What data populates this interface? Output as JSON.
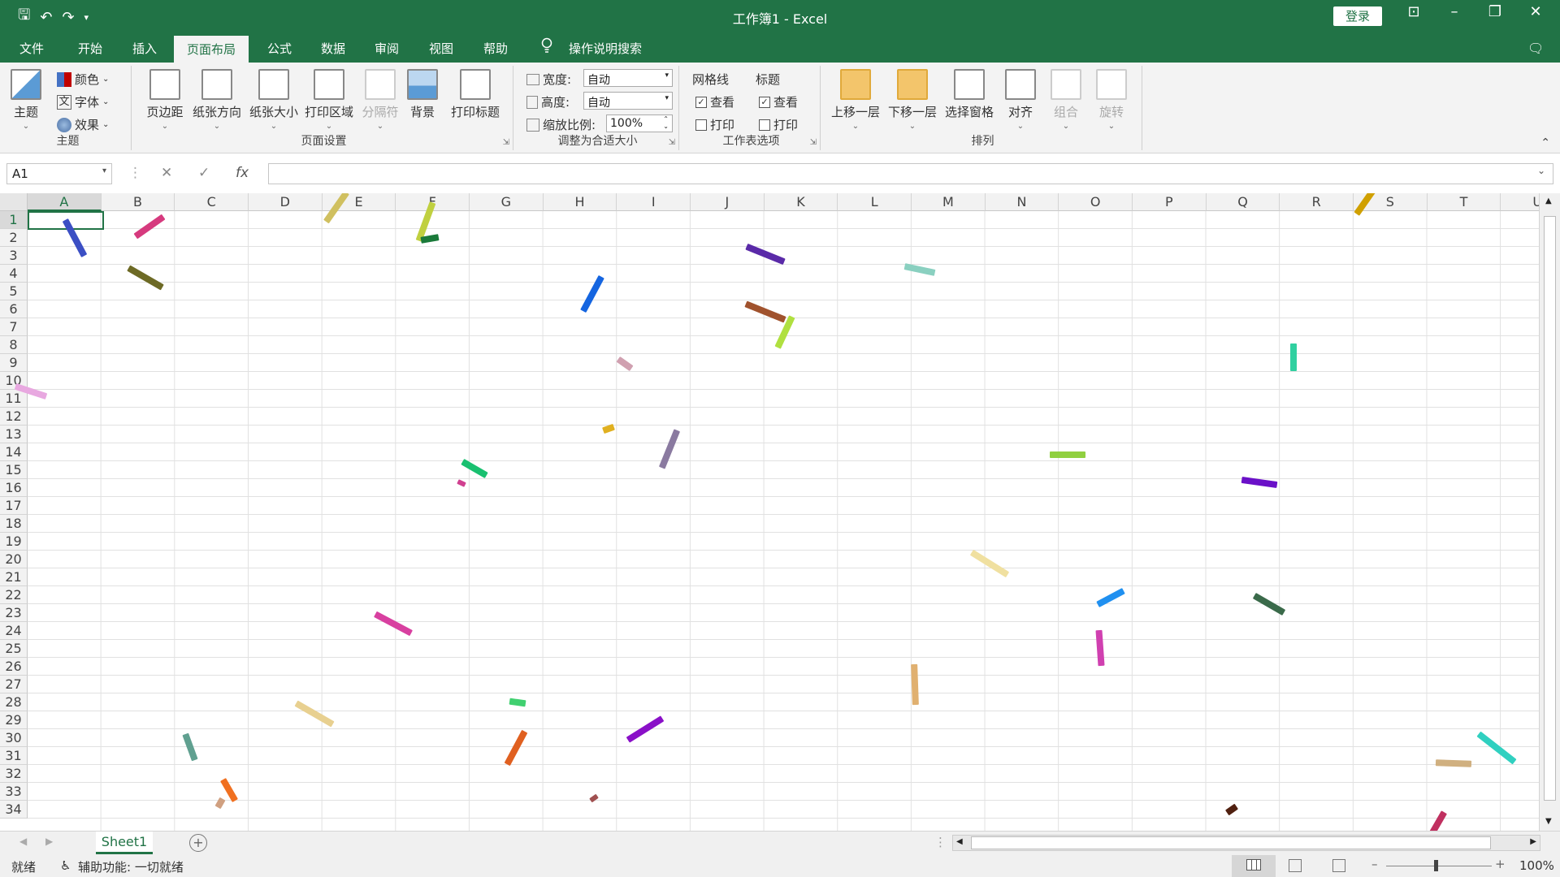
{
  "titlebar": {
    "title": "工作簿1  -  Excel",
    "login": "登录"
  },
  "tabs": {
    "file": "文件",
    "home": "开始",
    "insert": "插入",
    "page_layout": "页面布局",
    "formulas": "公式",
    "data": "数据",
    "review": "审阅",
    "view": "视图",
    "help": "帮助",
    "tell_me": "操作说明搜索"
  },
  "ribbon": {
    "themes_group": {
      "label": "主题",
      "theme": "主题",
      "colors": "颜色",
      "fonts": "字体",
      "effects": "效果"
    },
    "page_setup_group": {
      "label": "页面设置",
      "margins": "页边距",
      "orientation": "纸张方向",
      "size": "纸张大小",
      "print_area": "打印区域",
      "breaks": "分隔符",
      "background": "背景",
      "print_titles": "打印标题"
    },
    "scale_group": {
      "label": "调整为合适大小",
      "width_label": "宽度:",
      "width_value": "自动",
      "height_label": "高度:",
      "height_value": "自动",
      "scale_label": "缩放比例:",
      "scale_value": "100%"
    },
    "sheet_options_group": {
      "label": "工作表选项",
      "gridlines": "网格线",
      "headings": "标题",
      "view": "查看",
      "print": "打印"
    },
    "arrange_group": {
      "label": "排列",
      "bring_forward": "上移一层",
      "send_backward": "下移一层",
      "selection_pane": "选择窗格",
      "align": "对齐",
      "group": "组合",
      "rotate": "旋转"
    }
  },
  "formula_bar": {
    "name_box": "A1",
    "fx": "fx"
  },
  "columns": [
    "A",
    "B",
    "C",
    "D",
    "E",
    "F",
    "G",
    "H",
    "I",
    "J",
    "K",
    "L",
    "M",
    "N",
    "O",
    "P",
    "Q",
    "R",
    "S",
    "T",
    "U"
  ],
  "rows": [
    "1",
    "2",
    "3",
    "4",
    "5",
    "6",
    "7",
    "8",
    "9",
    "10",
    "11",
    "12",
    "13",
    "14",
    "15",
    "16",
    "17",
    "18",
    "19",
    "20",
    "21",
    "22",
    "23",
    "24",
    "25",
    "26",
    "27",
    "28",
    "29",
    "30",
    "31",
    "32",
    "33",
    "34"
  ],
  "sheet": {
    "tab": "Sheet1"
  },
  "status": {
    "ready": "就绪",
    "accessibility": "辅助功能: 一切就绪",
    "zoom": "100%"
  },
  "colors": {
    "brand": "#217346"
  }
}
